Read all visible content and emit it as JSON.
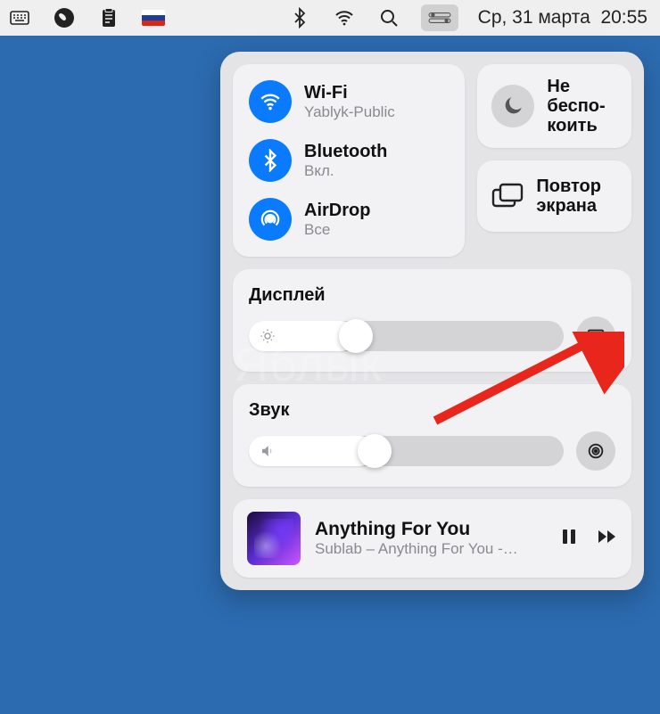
{
  "menubar": {
    "date": "Ср, 31 марта",
    "time": "20:55",
    "icons": {
      "keyboard": "keyboard-icon",
      "viber": "viber-icon",
      "clipboard": "clipboard-icon",
      "flag": "russian-flag",
      "bluetooth": "bluetooth-icon",
      "wifi": "wifi-icon",
      "spotlight": "search-icon",
      "control_center": "control-center-icon"
    }
  },
  "control_center": {
    "wifi": {
      "title": "Wi-Fi",
      "subtitle": "Yablyk-Public"
    },
    "bluetooth": {
      "title": "Bluetooth",
      "subtitle": "Вкл."
    },
    "airdrop": {
      "title": "AirDrop",
      "subtitle": "Все"
    },
    "dnd": {
      "label": "Не беспо-\nкоить"
    },
    "screen_mirror": {
      "label": "Повтор\nэкрана"
    },
    "display": {
      "label": "Дисплей",
      "value_percent": 34
    },
    "sound": {
      "label": "Звук",
      "value_percent": 40
    },
    "media": {
      "title": "Anything For You",
      "subtitle": "Sublab – Anything For You -…"
    }
  },
  "watermark": "Яблык"
}
